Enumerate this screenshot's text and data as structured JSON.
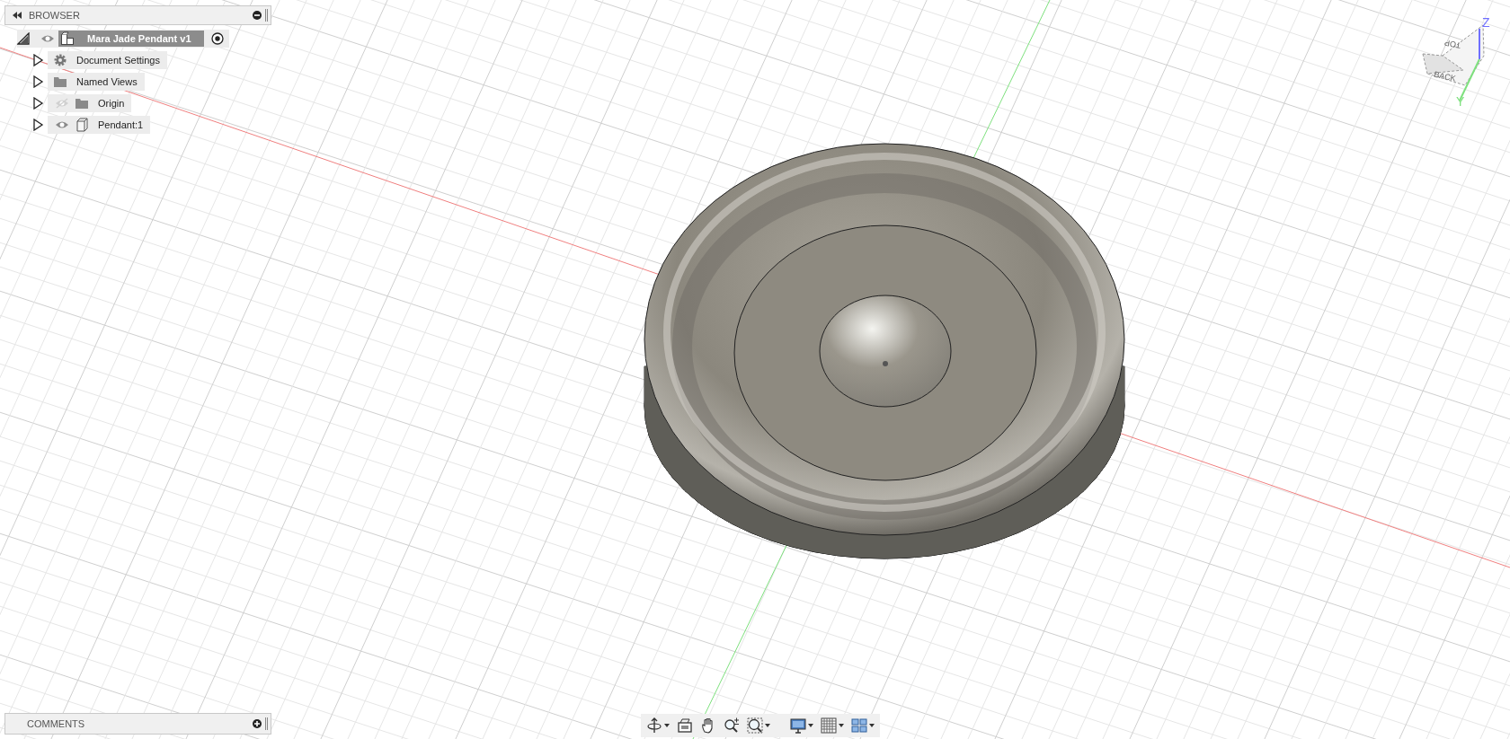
{
  "browser": {
    "title": "BROWSER",
    "tree": {
      "label": "Mara Jade Pendant v1",
      "kind": "component",
      "visible": true,
      "selected": true,
      "expanded": true,
      "active": true,
      "children": [
        {
          "label": "Document Settings",
          "kind": "gear",
          "expanded": false
        },
        {
          "label": "Named Views",
          "kind": "folder",
          "expanded": false
        },
        {
          "label": "Origin",
          "kind": "folder",
          "visible": false,
          "expanded": false
        },
        {
          "label": "Pendant:1",
          "kind": "body",
          "visible": true,
          "expanded": false
        }
      ]
    }
  },
  "view_cube": {
    "faces": [
      "TOP",
      "BACK"
    ],
    "axes": [
      "Z",
      "Y"
    ]
  },
  "comments": {
    "title": "COMMENTS"
  },
  "toolbar": [
    {
      "kind": "orbit",
      "dropdown": true
    },
    {
      "kind": "look",
      "dropdown": false
    },
    {
      "kind": "pan",
      "dropdown": false
    },
    {
      "kind": "zoom",
      "dropdown": false
    },
    {
      "kind": "fit",
      "dropdown": true
    },
    {
      "kind": "display",
      "dropdown": true
    },
    {
      "kind": "grid",
      "dropdown": true
    },
    {
      "kind": "viewports",
      "dropdown": true
    }
  ]
}
